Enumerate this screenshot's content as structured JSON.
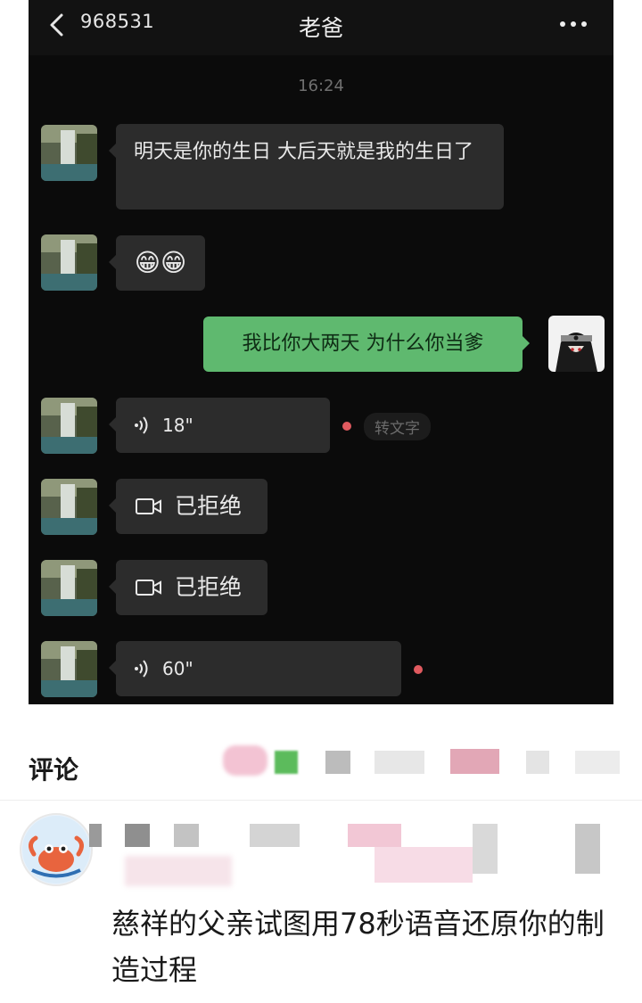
{
  "header": {
    "unread_count": "968531",
    "title": "老爸"
  },
  "chat": {
    "timestamp": "16:24",
    "messages": [
      {
        "side": "left",
        "type": "text",
        "text": "明天是你的生日 大后天就是我的生日了"
      },
      {
        "side": "left",
        "type": "emoji",
        "emoji": "😁😁"
      },
      {
        "side": "right",
        "type": "text",
        "text": "我比你大两天 为什么你当爹"
      },
      {
        "side": "left",
        "type": "voice",
        "duration": "18\"",
        "unread": true,
        "convert_label": "转文字"
      },
      {
        "side": "left",
        "type": "video_call",
        "status": "已拒绝"
      },
      {
        "side": "left",
        "type": "video_call",
        "status": "已拒绝"
      },
      {
        "side": "left",
        "type": "voice",
        "duration": "60\"",
        "unread": true
      }
    ]
  },
  "comments": {
    "section_title": "评论",
    "comment_text": "慈祥的父亲试图用78秒语音还原你的制造过程"
  },
  "colors": {
    "chat_bg": "#0b0b0b",
    "bubble_left": "#2c2c2c",
    "bubble_right": "#5fb96f",
    "unread_dot": "#e05a5f"
  }
}
